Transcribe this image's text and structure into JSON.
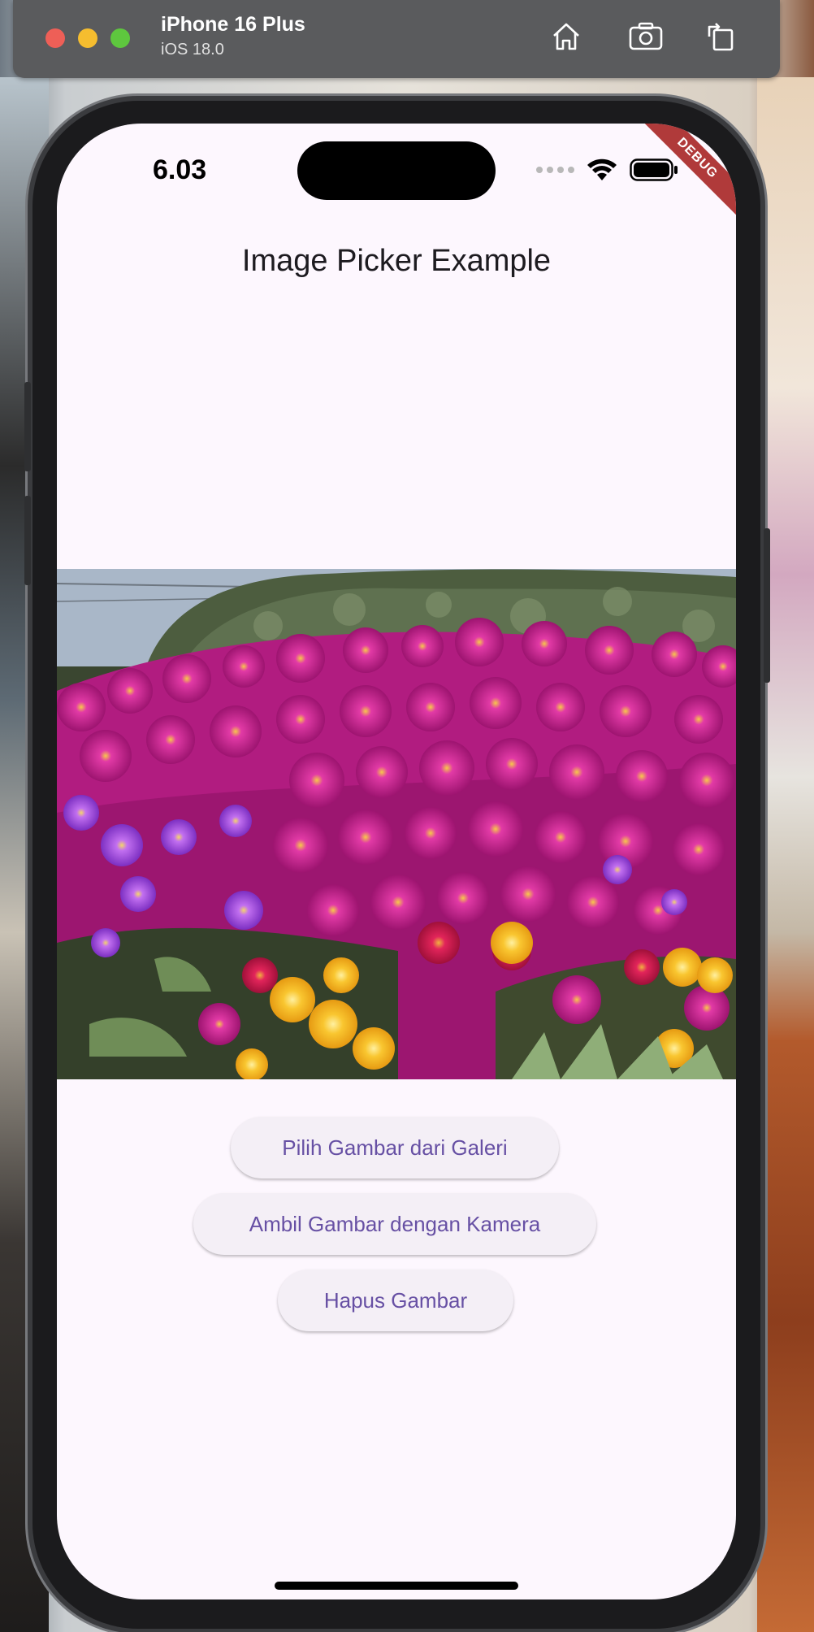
{
  "simulator": {
    "device_name": "iPhone 16 Plus",
    "os_version": "iOS 18.0",
    "toolbar_icons": [
      "home-icon",
      "screenshot-icon",
      "rotate-icon"
    ]
  },
  "status_bar": {
    "time": "6.03",
    "icons": [
      "cellular-signal-icon",
      "wifi-icon",
      "battery-icon"
    ]
  },
  "debug_banner": "DEBUG",
  "app": {
    "title": "Image Picker Example",
    "selected_image": "photo of magenta, purple and yellow ice plant flowers",
    "buttons": {
      "gallery": "Pilih Gambar dari Galeri",
      "camera": "Ambil Gambar dengan Kamera",
      "clear": "Hapus Gambar"
    }
  },
  "colors": {
    "accent": "#6750a4",
    "surface": "#fdf7fe",
    "button_bg": "#f4eff6",
    "debug_ribbon": "#b03a3a"
  }
}
